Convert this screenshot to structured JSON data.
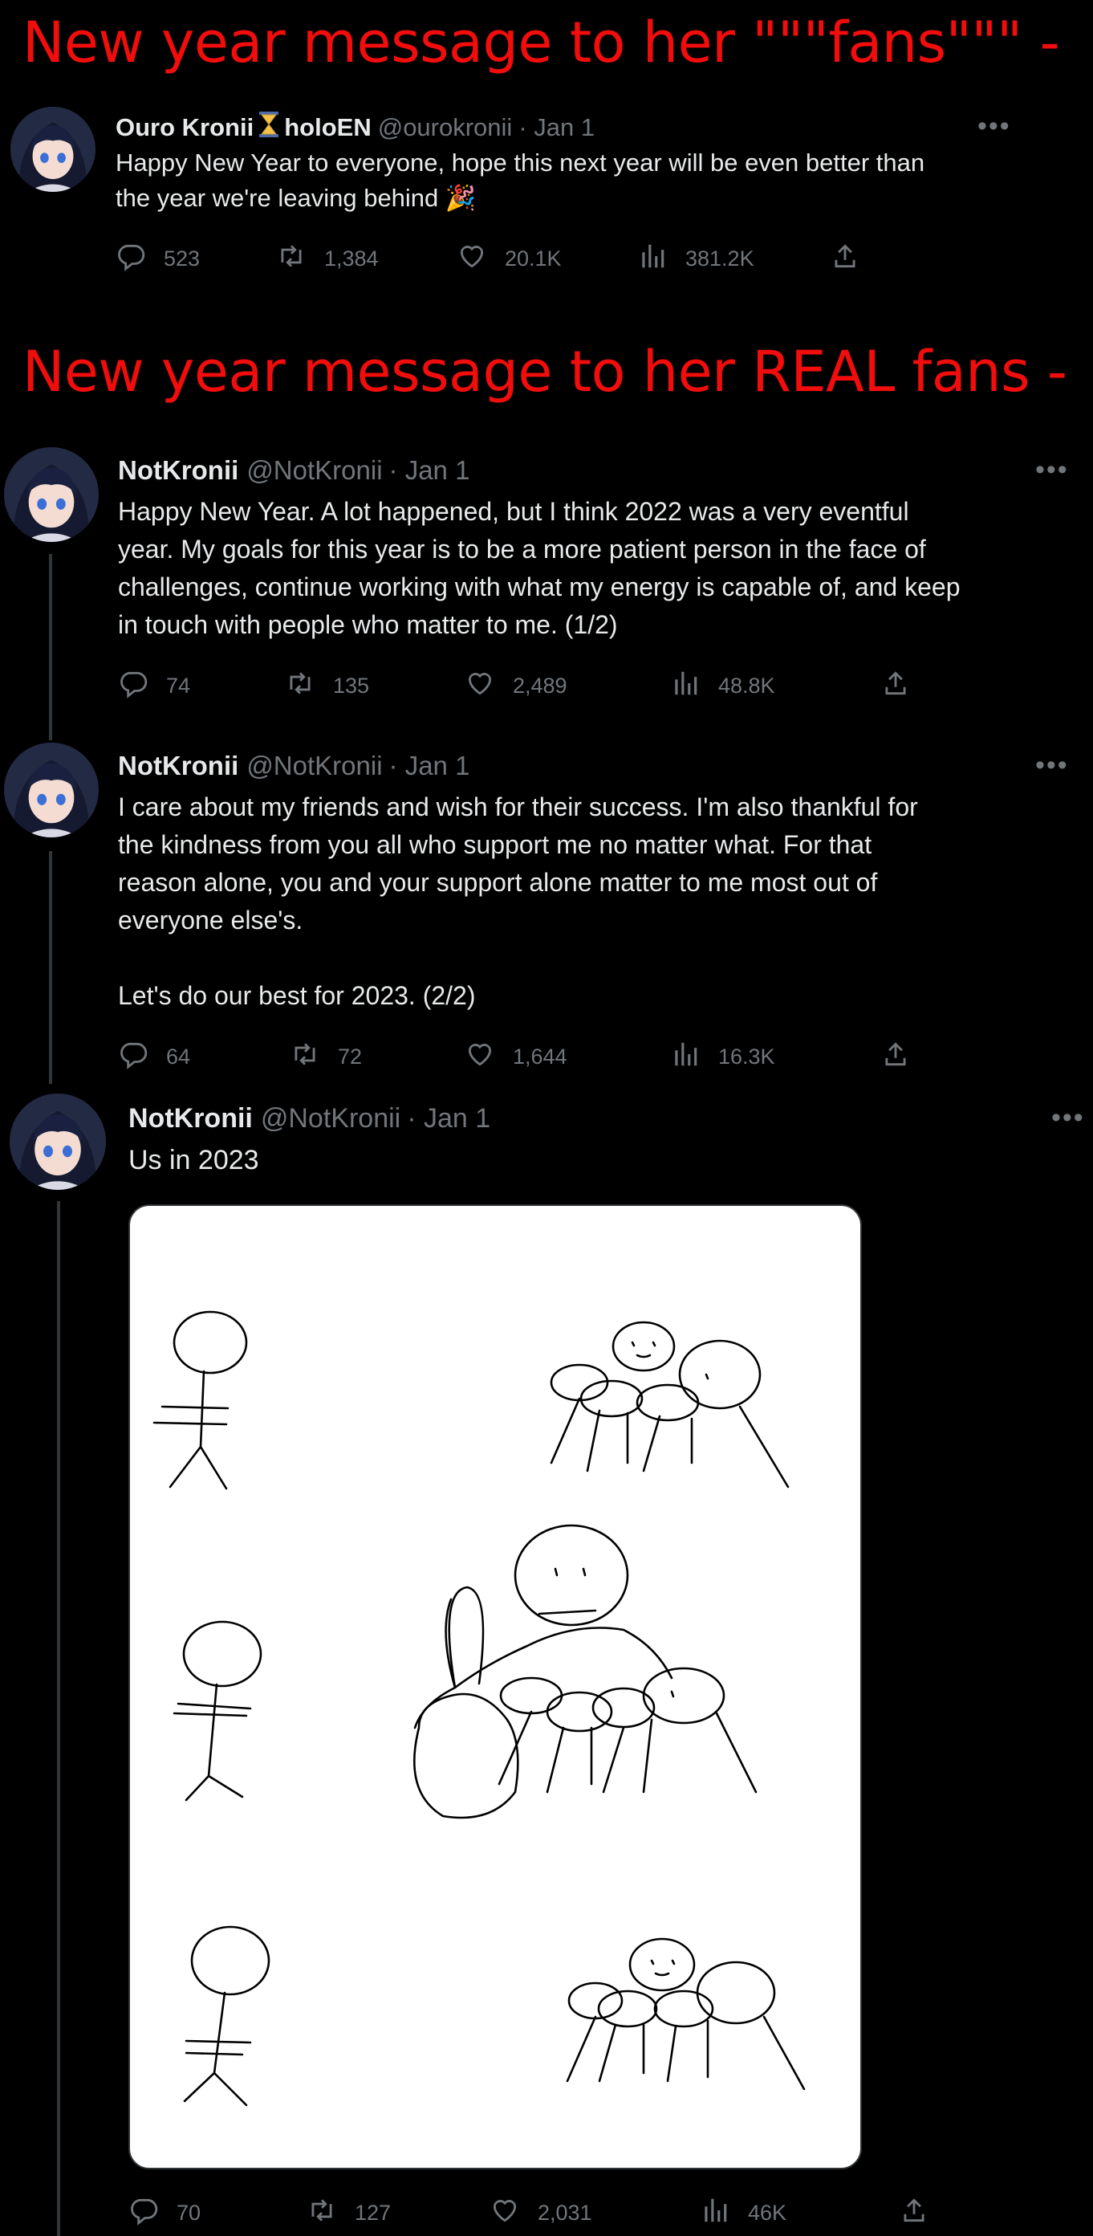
{
  "captions": {
    "first": "New year message to her \"\"\"fans\"\"\" -",
    "second": "New year message to her REAL fans -"
  },
  "tweets": [
    {
      "name": "Ouro Kronii",
      "badge_icon": "hourglass-icon",
      "affiliation": "holoEN",
      "handle": "@ourokronii",
      "date": "· Jan 1",
      "text": "Happy New Year to everyone, hope this next year will be even better than\nthe year we're leaving behind 🎉",
      "replies": "523",
      "retweets": "1,384",
      "likes": "20.1K",
      "views": "381.2K"
    },
    {
      "name": "NotKronii",
      "handle": "@NotKronii",
      "date": "· Jan 1",
      "text": "Happy New Year. A lot happened, but I think 2022 was a very eventful\nyear. My goals for this year is to be a more patient person in the face of\nchallenges, continue working with what my energy is capable of, and keep\nin touch with people who matter to me. (1/2)",
      "replies": "74",
      "retweets": "135",
      "likes": "2,489",
      "views": "48.8K"
    },
    {
      "name": "NotKronii",
      "handle": "@NotKronii",
      "date": "· Jan 1",
      "text": "I care about my friends and wish for their success. I'm also thankful for\nthe kindness from you all who support me no matter what. For that\nreason alone, you and your support alone matter to me most out of\neveryone else's.\n\nLet's do our best for 2023. (2/2)",
      "replies": "64",
      "retweets": "72",
      "likes": "1,644",
      "views": "16.3K"
    },
    {
      "name": "NotKronii",
      "handle": "@NotKronii",
      "date": "· Jan 1",
      "text": "Us in 2023",
      "replies": "70",
      "retweets": "127",
      "likes": "2,031",
      "views": "46K"
    }
  ],
  "icons": {
    "more": "more-horizontal-icon",
    "reply": "reply-icon",
    "retweet": "retweet-icon",
    "like": "heart-icon",
    "views": "views-icon",
    "share": "share-icon"
  },
  "colors": {
    "background": "#000000",
    "caption_red": "#f20d0d",
    "primary_text": "#e7e9ea",
    "secondary_text": "#71767b",
    "thread_line": "#333639"
  }
}
